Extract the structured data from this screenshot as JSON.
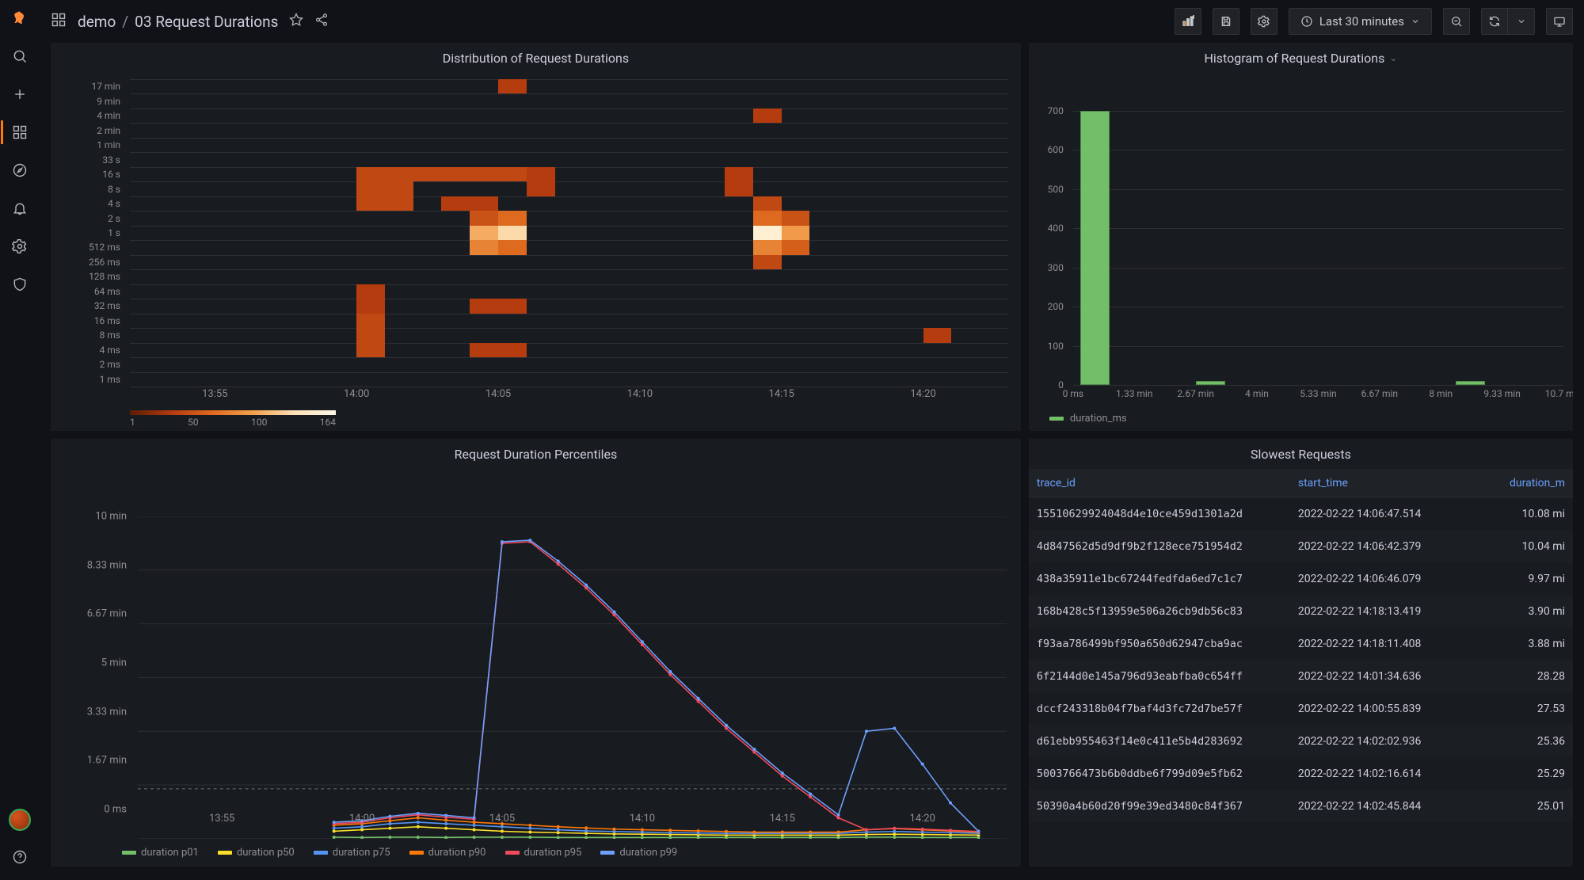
{
  "breadcrumb": {
    "folder": "demo",
    "page": "03 Request Durations"
  },
  "timerange": "Last 30 minutes",
  "sidenav": {
    "items": [
      "search",
      "create",
      "dashboards",
      "explore",
      "alerting",
      "configuration",
      "admin"
    ],
    "bottom": [
      "profile",
      "help"
    ]
  },
  "toolbar": {
    "addPanel": "Add panel",
    "save": "Save dashboard",
    "settings": "Dashboard settings",
    "zoomOut": "Zoom out",
    "refresh": "Refresh",
    "cycle": "Cycle view"
  },
  "panels": {
    "heatmap": {
      "title": "Distribution of Request Durations"
    },
    "histogram": {
      "title": "Histogram of Request Durations"
    },
    "percentiles": {
      "title": "Request Duration Percentiles"
    },
    "slowest": {
      "title": "Slowest Requests"
    }
  },
  "chart_data": [
    {
      "id": "heatmap",
      "type": "heatmap",
      "title": "Distribution of Request Durations",
      "xticks": [
        "13:55",
        "14:00",
        "14:05",
        "14:10",
        "14:15",
        "14:20"
      ],
      "xrange": [
        "13:52",
        "14:23"
      ],
      "ybuckets": [
        "17 min",
        "9 min",
        "4 min",
        "2 min",
        "1 min",
        "33 s",
        "16 s",
        "8 s",
        "4 s",
        "2 s",
        "1 s",
        "512 ms",
        "256 ms",
        "128 ms",
        "64 ms",
        "32 ms",
        "16 ms",
        "8 ms",
        "4 ms",
        "2 ms",
        "1 ms"
      ],
      "color_scale": {
        "min": 1,
        "ticks": [
          1,
          50,
          100,
          164
        ],
        "max": 164
      },
      "cells_comment": "cells given as [x_index(0-30), y_index(0=top), intensity 0-1]",
      "cells": [
        [
          8,
          6,
          0.35
        ],
        [
          9,
          6,
          0.35
        ],
        [
          10,
          6,
          0.35
        ],
        [
          11,
          6,
          0.35
        ],
        [
          12,
          6,
          0.35
        ],
        [
          13,
          6,
          0.35
        ],
        [
          8,
          7,
          0.35
        ],
        [
          9,
          7,
          0.35
        ],
        [
          14,
          6,
          0.3
        ],
        [
          14,
          7,
          0.3
        ],
        [
          8,
          8,
          0.35
        ],
        [
          9,
          8,
          0.35
        ],
        [
          8,
          14,
          0.3
        ],
        [
          8,
          15,
          0.3
        ],
        [
          8,
          16,
          0.35
        ],
        [
          8,
          17,
          0.35
        ],
        [
          8,
          18,
          0.35
        ],
        [
          13,
          0,
          0.3
        ],
        [
          11,
          8,
          0.3
        ],
        [
          12,
          8,
          0.3
        ],
        [
          12,
          9,
          0.4
        ],
        [
          13,
          9,
          0.5
        ],
        [
          12,
          10,
          0.75
        ],
        [
          13,
          10,
          0.9
        ],
        [
          12,
          11,
          0.6
        ],
        [
          13,
          11,
          0.5
        ],
        [
          12,
          15,
          0.3
        ],
        [
          13,
          15,
          0.3
        ],
        [
          12,
          18,
          0.3
        ],
        [
          13,
          18,
          0.3
        ],
        [
          21,
          6,
          0.3
        ],
        [
          21,
          7,
          0.3
        ],
        [
          22,
          2,
          0.3
        ],
        [
          22,
          8,
          0.35
        ],
        [
          22,
          9,
          0.5
        ],
        [
          23,
          9,
          0.4
        ],
        [
          22,
          10,
          0.98
        ],
        [
          23,
          10,
          0.7
        ],
        [
          22,
          11,
          0.6
        ],
        [
          23,
          11,
          0.45
        ],
        [
          22,
          12,
          0.35
        ],
        [
          28,
          17,
          0.3
        ]
      ]
    },
    {
      "id": "histogram",
      "type": "bar",
      "title": "Histogram of Request Durations",
      "xlabel": "",
      "ylabel": "",
      "yticks": [
        0,
        100,
        200,
        300,
        400,
        500,
        600,
        700
      ],
      "xticks": [
        "0 ms",
        "1.33 min",
        "2.67 min",
        "4 min",
        "5.33 min",
        "6.67 min",
        "8 min",
        "9.33 min",
        "10.7 min"
      ],
      "series": [
        {
          "name": "duration_ms",
          "color": "#73bf69"
        }
      ],
      "bars_comment": "[x_frac(0-1), height_value]",
      "bars": [
        [
          0.015,
          700
        ],
        [
          0.25,
          6
        ],
        [
          0.78,
          8
        ]
      ]
    },
    {
      "id": "percentiles",
      "type": "line",
      "title": "Request Duration Percentiles",
      "yticks": [
        "0 ms",
        "1.67 min",
        "3.33 min",
        "5 min",
        "6.67 min",
        "8.33 min",
        "10 min"
      ],
      "xticks": [
        "13:55",
        "14:00",
        "14:05",
        "14:10",
        "14:15",
        "14:20"
      ],
      "x": [
        "13:59",
        "14:00",
        "14:01",
        "14:02",
        "14:03",
        "14:04",
        "14:05",
        "14:06",
        "14:07",
        "14:08",
        "14:09",
        "14:10",
        "14:11",
        "14:12",
        "14:13",
        "14:14",
        "14:15",
        "14:16",
        "14:17",
        "14:18",
        "14:19",
        "14:20",
        "14:21",
        "14:22"
      ],
      "ymax_min": 10.8,
      "series": [
        {
          "name": "duration p01",
          "color": "#73bf69",
          "values": [
            0.05,
            0.04,
            0.05,
            0.05,
            0.04,
            0.05,
            0.05,
            0.05,
            0.04,
            0.04,
            0.04,
            0.04,
            0.04,
            0.04,
            0.04,
            0.04,
            0.04,
            0.04,
            0.04,
            0.05,
            0.05,
            0.04,
            0.04,
            0.04
          ]
        },
        {
          "name": "duration p50",
          "color": "#fade2a",
          "values": [
            0.25,
            0.3,
            0.35,
            0.4,
            0.35,
            0.3,
            0.25,
            0.22,
            0.2,
            0.18,
            0.16,
            0.15,
            0.14,
            0.13,
            0.12,
            0.12,
            0.12,
            0.12,
            0.12,
            0.14,
            0.15,
            0.14,
            0.13,
            0.12
          ]
        },
        {
          "name": "duration p75",
          "color": "#5794f2",
          "values": [
            0.35,
            0.4,
            0.5,
            0.55,
            0.5,
            0.45,
            0.4,
            0.35,
            0.3,
            0.26,
            0.24,
            0.22,
            0.2,
            0.19,
            0.18,
            0.18,
            0.18,
            0.18,
            0.18,
            0.22,
            0.24,
            0.22,
            0.2,
            0.18
          ]
        },
        {
          "name": "duration p90",
          "color": "#ff780a",
          "values": [
            0.45,
            0.5,
            0.6,
            0.7,
            0.62,
            0.55,
            0.5,
            0.45,
            0.4,
            0.36,
            0.32,
            0.3,
            0.28,
            0.26,
            0.24,
            0.22,
            0.22,
            0.22,
            0.22,
            0.3,
            0.34,
            0.3,
            0.26,
            0.22
          ]
        },
        {
          "name": "duration p95",
          "color": "#f2495c",
          "values": [
            0.5,
            0.55,
            0.7,
            0.8,
            0.72,
            0.65,
            9.9,
            9.95,
            9.2,
            8.4,
            7.5,
            6.5,
            5.5,
            4.6,
            3.7,
            2.9,
            2.1,
            1.4,
            0.7,
            0.3,
            0.35,
            0.32,
            0.28,
            0.24
          ]
        },
        {
          "name": "duration p99",
          "color": "#6e9fff",
          "values": [
            0.55,
            0.6,
            0.75,
            0.85,
            0.78,
            0.7,
            9.95,
            10.0,
            9.3,
            8.5,
            7.6,
            6.6,
            5.6,
            4.7,
            3.8,
            3.0,
            2.2,
            1.5,
            0.8,
            3.6,
            3.7,
            2.5,
            1.2,
            0.25
          ]
        }
      ],
      "dashed_ref": 1.67
    },
    {
      "id": "slowest",
      "type": "table",
      "title": "Slowest Requests",
      "columns": [
        "trace_id",
        "start_time",
        "duration_m"
      ],
      "rows": [
        [
          "15510629924048d4e10ce459d1301a2d",
          "2022-02-22 14:06:47.514",
          "10.08 mi"
        ],
        [
          "4d847562d5d9df9b2f128ece751954d2",
          "2022-02-22 14:06:42.379",
          "10.04 mi"
        ],
        [
          "438a35911e1bc67244fedfda6ed7c1c7",
          "2022-02-22 14:06:46.079",
          "9.97 mi"
        ],
        [
          "168b428c5f13959e506a26cb9db56c83",
          "2022-02-22 14:18:13.419",
          "3.90 mi"
        ],
        [
          "f93aa786499bf950a650d62947cba9ac",
          "2022-02-22 14:18:11.408",
          "3.88 mi"
        ],
        [
          "6f2144d0e145a796d93eabfba0c654ff",
          "2022-02-22 14:01:34.636",
          "28.28"
        ],
        [
          "dccf243318b04f7baf4d3fc72d7be57f",
          "2022-02-22 14:00:55.839",
          "27.53"
        ],
        [
          "d61ebb955463f14e0c411e5b4d283692",
          "2022-02-22 14:02:02.936",
          "25.36"
        ],
        [
          "5003766473b6b0ddbe6f799d09e5fb62",
          "2022-02-22 14:02:16.614",
          "25.29"
        ],
        [
          "50390a4b60d20f99e39ed3480c84f367",
          "2022-02-22 14:02:45.844",
          "25.01"
        ]
      ]
    }
  ]
}
